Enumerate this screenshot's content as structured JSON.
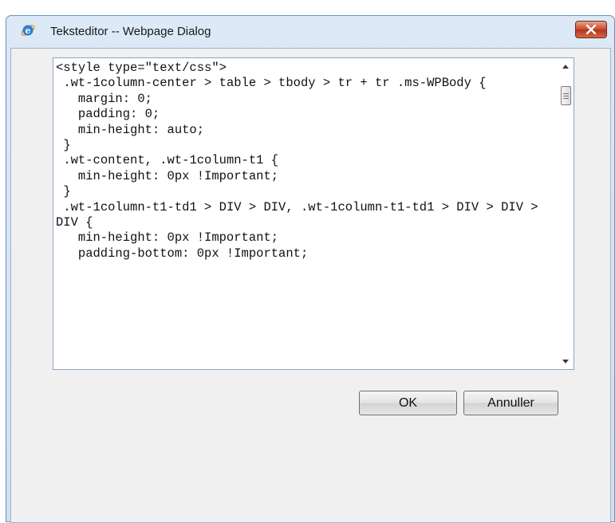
{
  "window": {
    "title": "Teksteditor -- Webpage Dialog",
    "icon": "internet-explorer-icon",
    "close_icon": "close-icon"
  },
  "editor": {
    "content": "<style type=\"text/css\">\n .wt-1column-center > table > tbody > tr + tr .ms-WPBody {\n   margin: 0;\n   padding: 0;\n   min-height: auto;\n }\n .wt-content, .wt-1column-t1 {\n   min-height: 0px !Important;\n }\n .wt-1column-t1-td1 > DIV > DIV, .wt-1column-t1-td1 > DIV > DIV > DIV {\n   min-height: 0px !Important;\n   padding-bottom: 0px !Important;"
  },
  "buttons": {
    "ok_label": "OK",
    "cancel_label": "Annuller"
  }
}
